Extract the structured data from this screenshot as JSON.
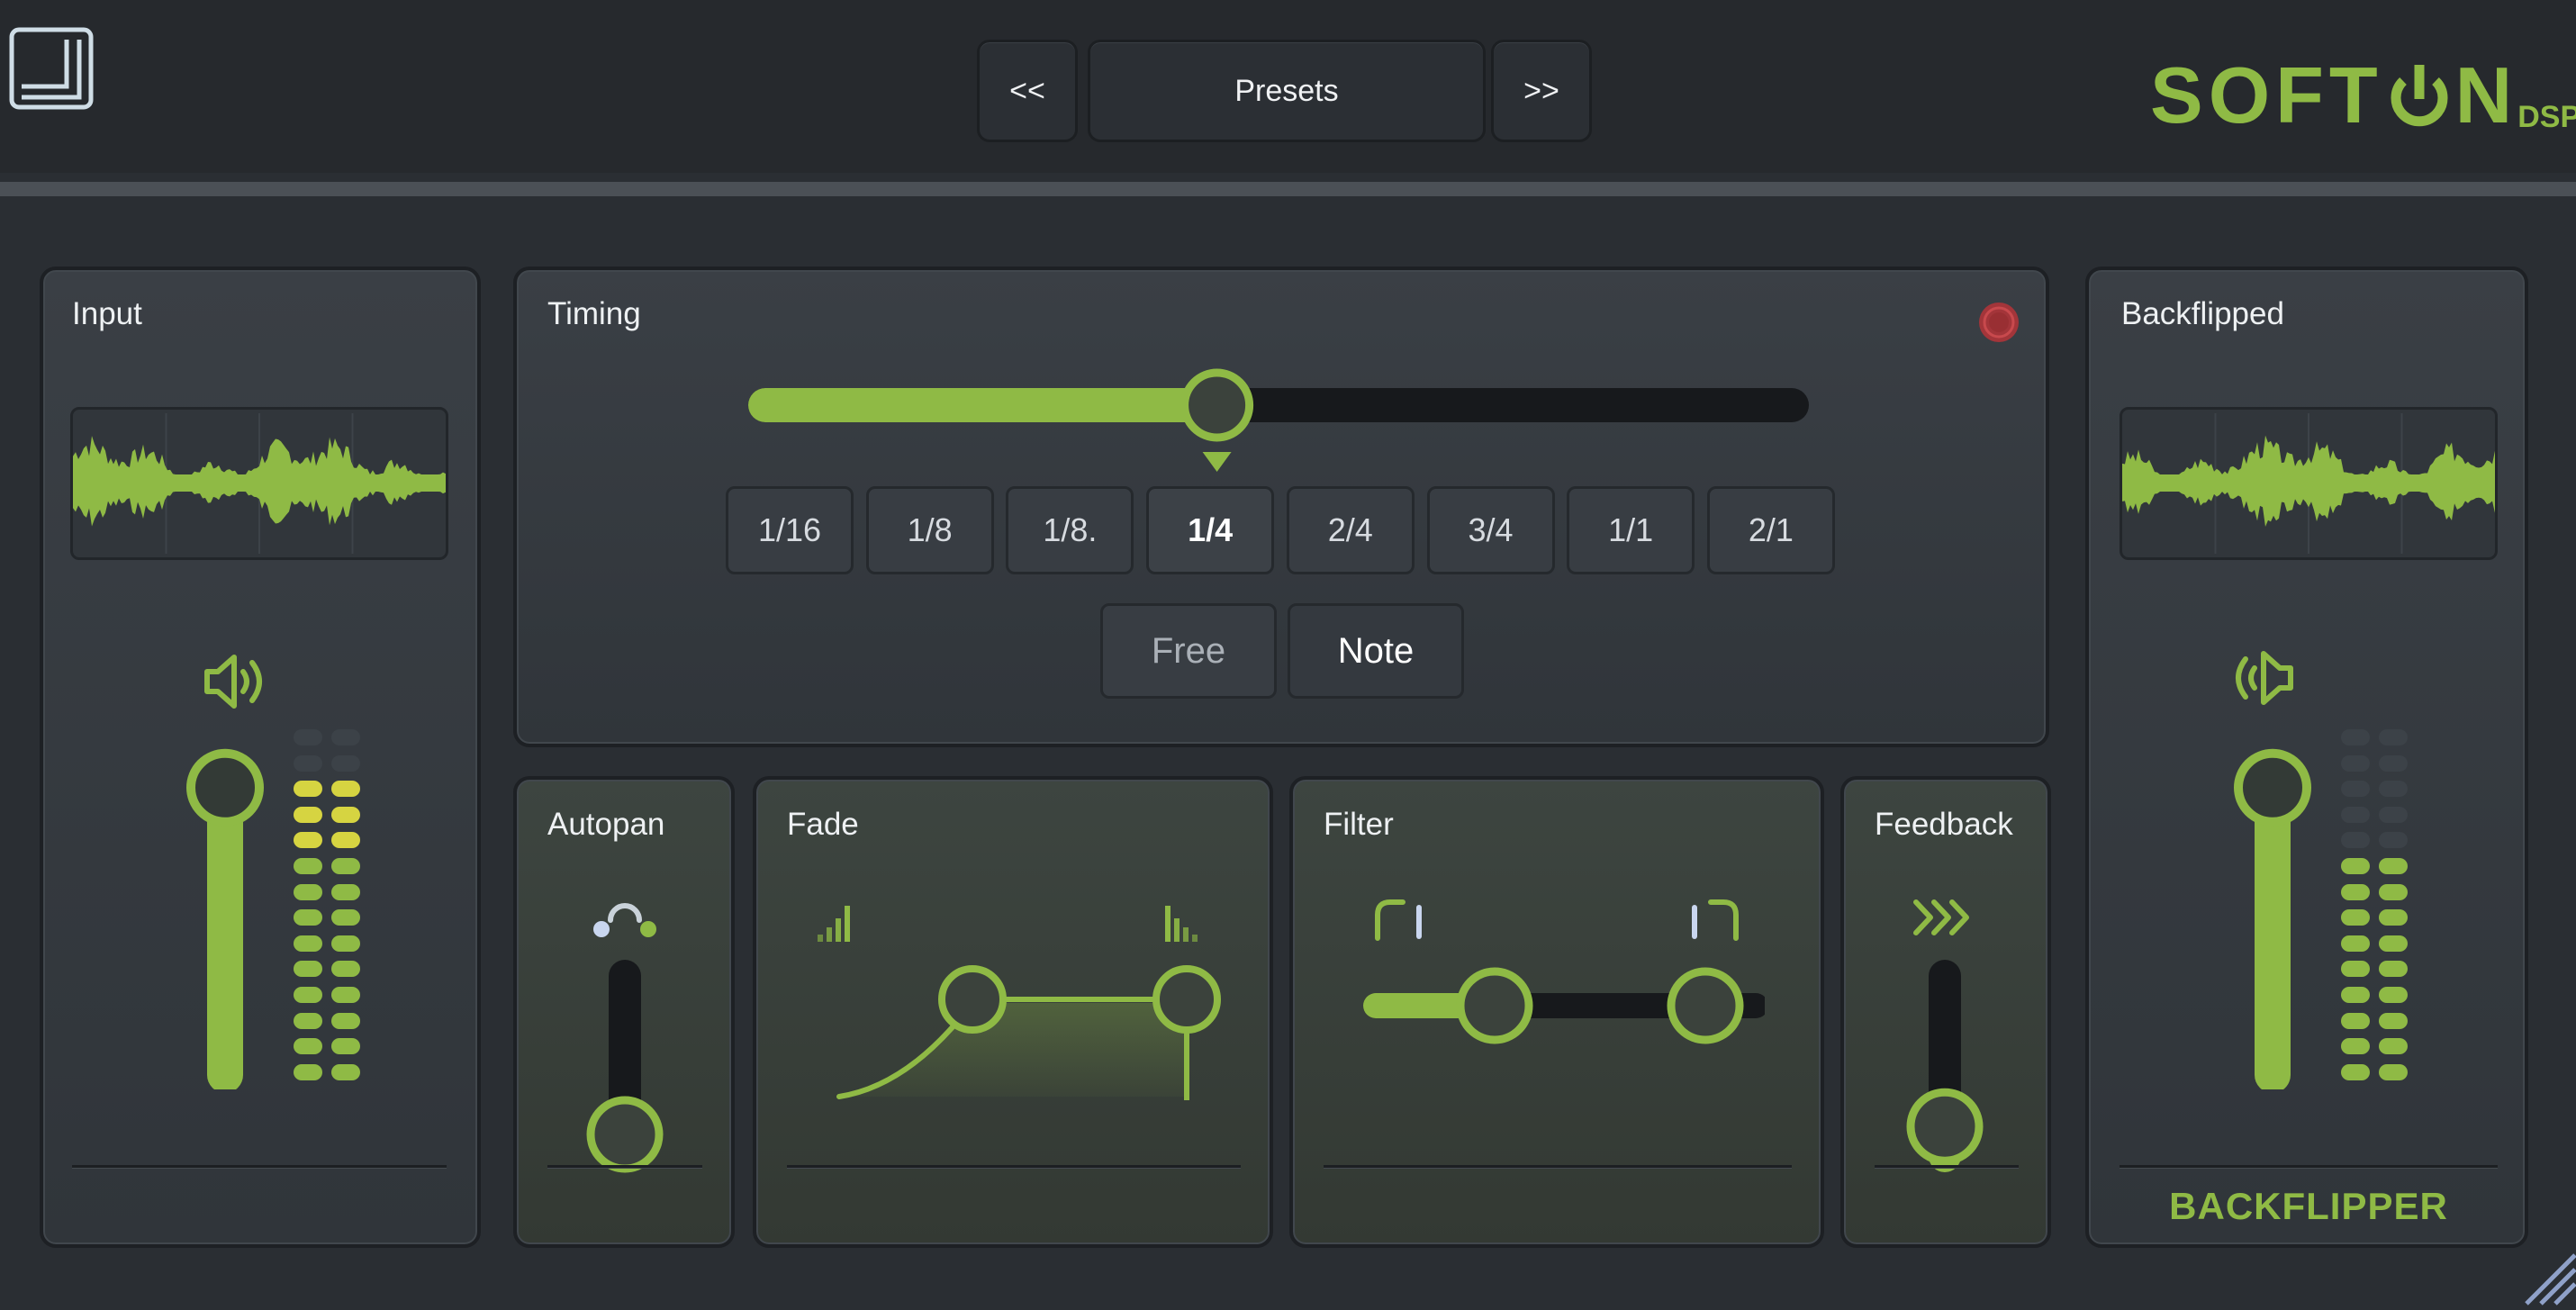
{
  "header": {
    "prev_label": "<<",
    "preset_label": "Presets",
    "next_label": ">>",
    "brand_main": "SOFT",
    "brand_tail": "N",
    "brand_dsp": "DSP"
  },
  "colors": {
    "accent": "#8fba45",
    "meter_yellow": "#d6d441",
    "record": "#b5383b",
    "background": "#2a2e33"
  },
  "input": {
    "title": "Input",
    "volume_level": 0.95,
    "meter_lit_rows": 12,
    "meter_total_rows": 14,
    "icon": "speaker-icon"
  },
  "timing": {
    "title": "Timing",
    "slider_fraction": 0.44,
    "notes": [
      "1/16",
      "1/8",
      "1/8.",
      "1/4",
      "2/4",
      "3/4",
      "1/1",
      "2/1"
    ],
    "selected_note": "1/4",
    "modes": [
      "Free",
      "Note"
    ],
    "selected_mode": "Note",
    "record_icon": "record-icon"
  },
  "output": {
    "title": "Backflipped",
    "volume_level": 0.95,
    "meter_lit_rows": 9,
    "meter_total_rows": 14,
    "product_name": "BACKFLIPPER"
  },
  "autopan": {
    "title": "Autopan",
    "level": 0.0
  },
  "fade": {
    "title": "Fade"
  },
  "filter": {
    "title": "Filter"
  },
  "feedback": {
    "title": "Feedback",
    "level": 0.05
  }
}
